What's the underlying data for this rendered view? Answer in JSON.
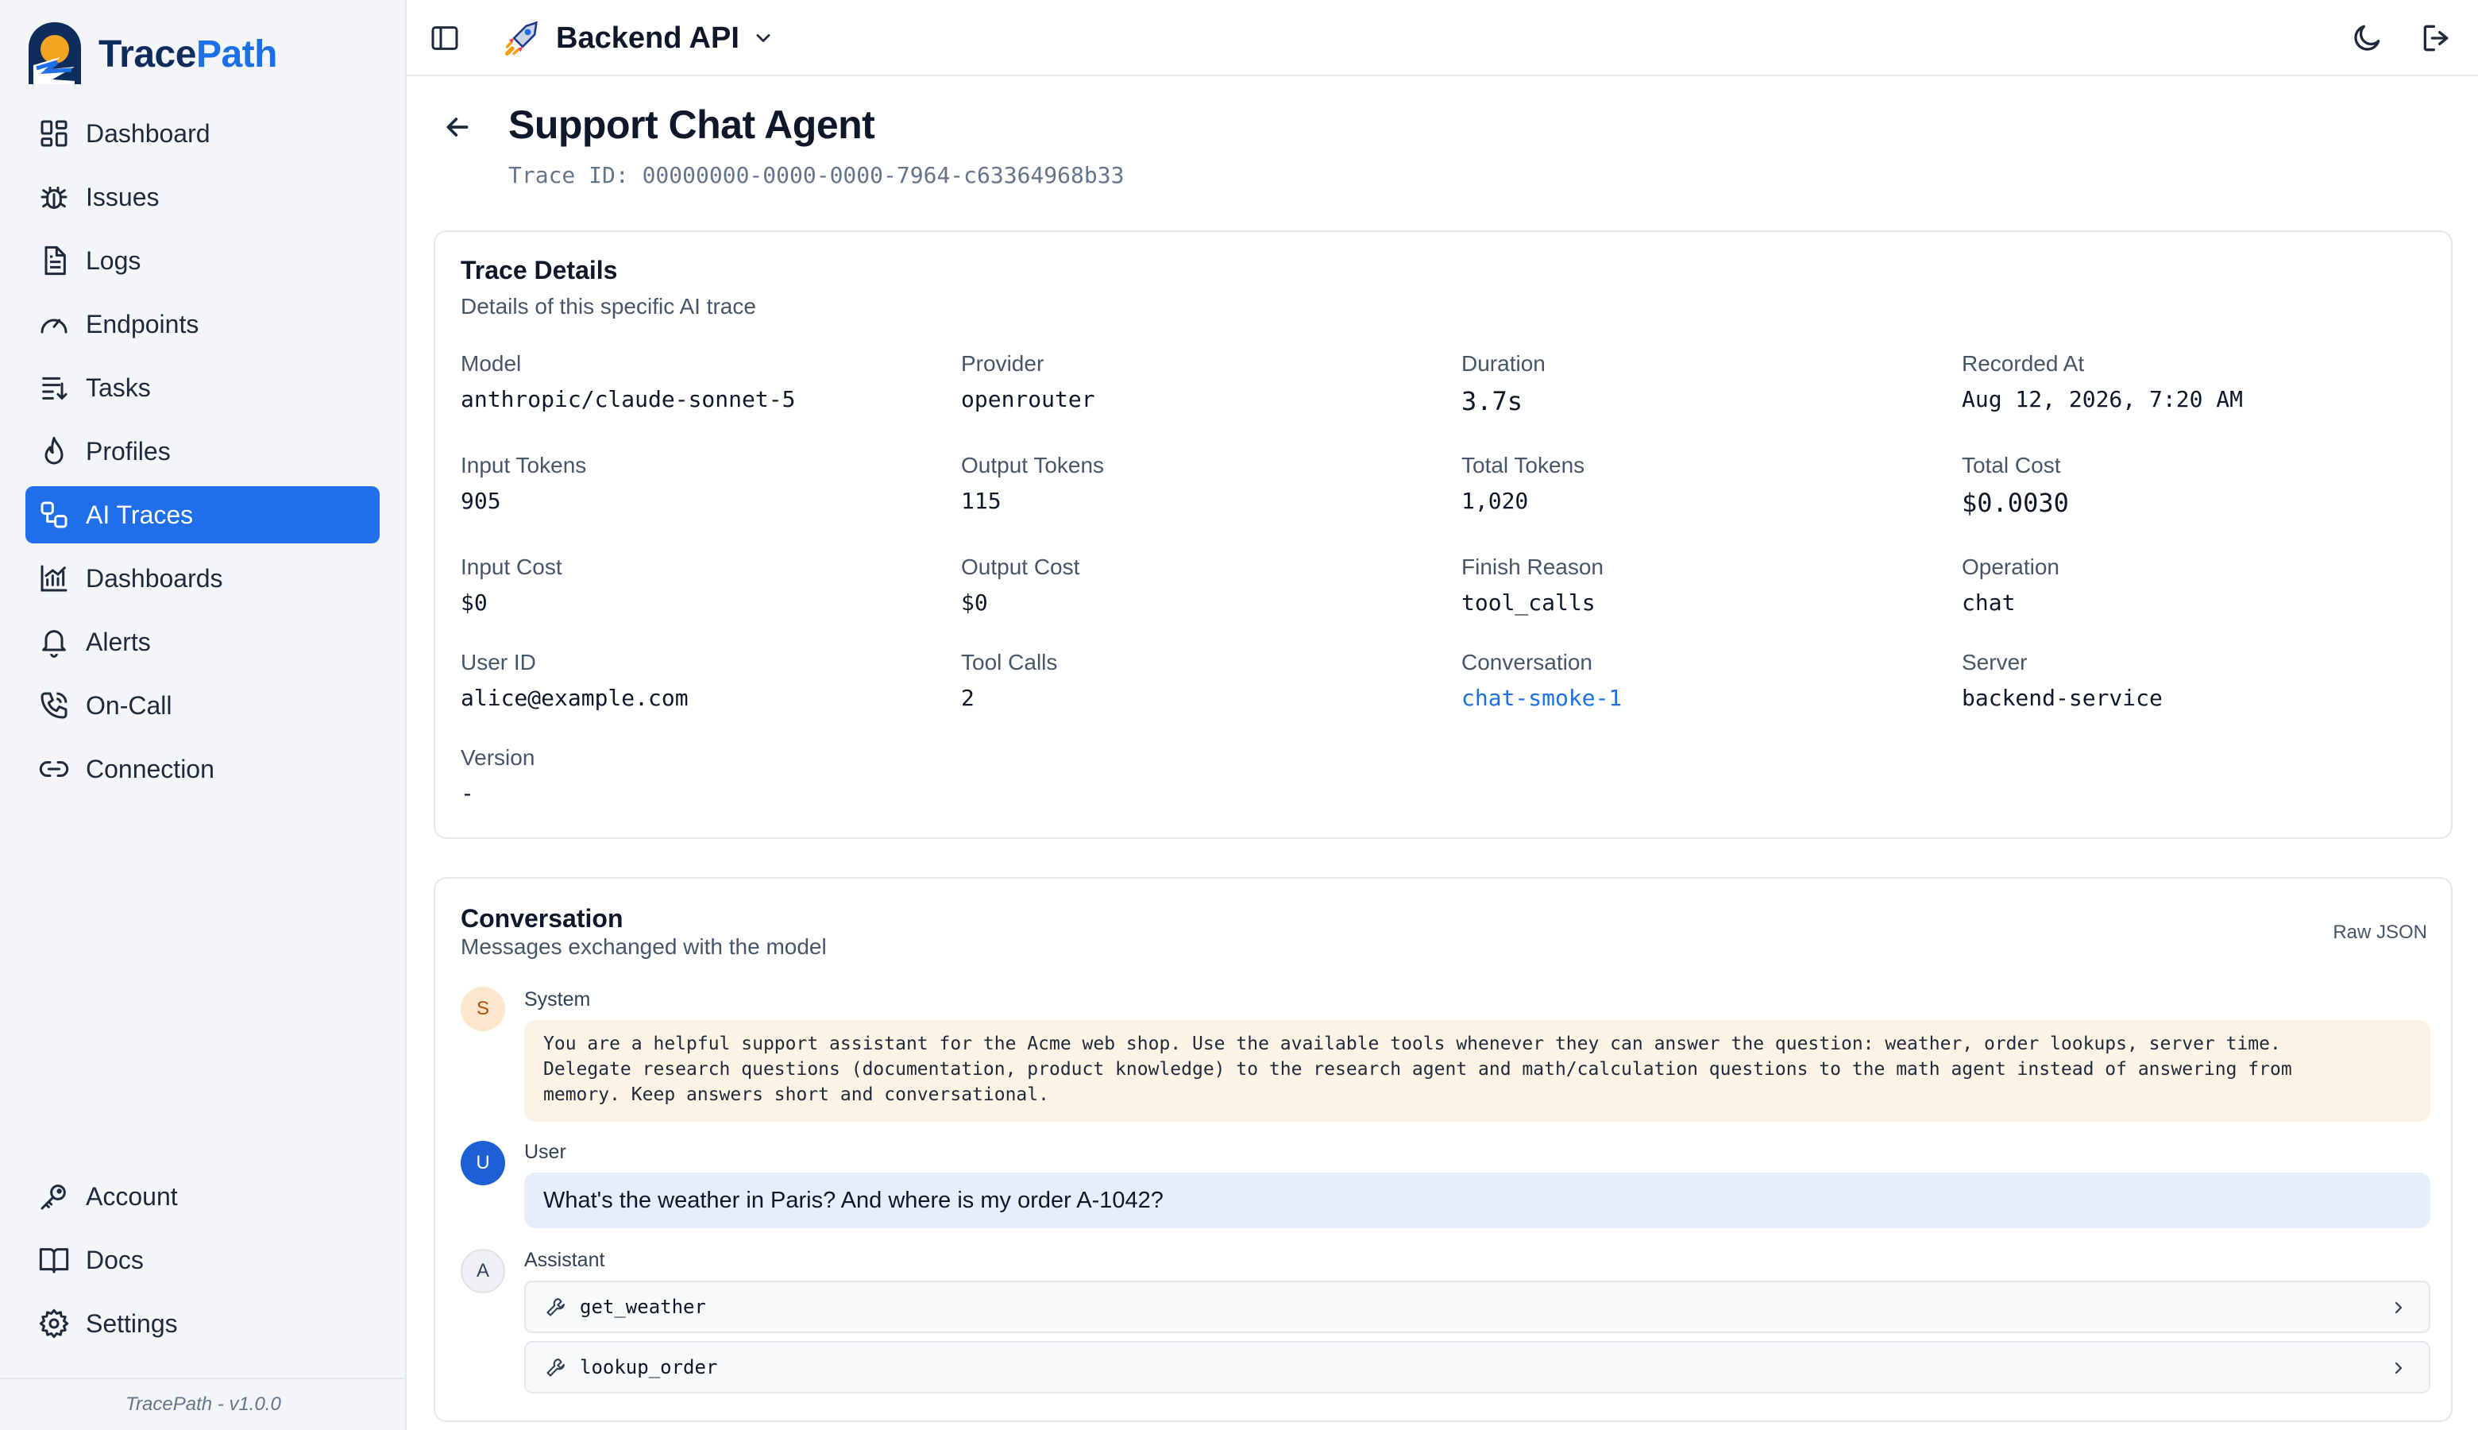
{
  "app": {
    "logo_trace": "Trace",
    "logo_path": "Path",
    "version": "TracePath - v1.0.0",
    "colors": {
      "accent": "#1f6feb",
      "link": "#1d6fe5",
      "system_bg": "#fdf3e4",
      "user_bg": "#e6edfb"
    }
  },
  "sidebar": {
    "items": [
      {
        "label": "Dashboard",
        "icon": "grid-icon"
      },
      {
        "label": "Issues",
        "icon": "bug-icon"
      },
      {
        "label": "Logs",
        "icon": "file-text-icon"
      },
      {
        "label": "Endpoints",
        "icon": "gauge-icon"
      },
      {
        "label": "Tasks",
        "icon": "list-icon"
      },
      {
        "label": "Profiles",
        "icon": "flame-icon"
      },
      {
        "label": "AI Traces",
        "icon": "workflow-icon",
        "active": true
      },
      {
        "label": "Dashboards",
        "icon": "chart-icon"
      },
      {
        "label": "Alerts",
        "icon": "bell-icon"
      },
      {
        "label": "On-Call",
        "icon": "phone-icon"
      },
      {
        "label": "Connection",
        "icon": "link-icon"
      }
    ],
    "bottom_items": [
      {
        "label": "Account",
        "icon": "key-icon"
      },
      {
        "label": "Docs",
        "icon": "book-icon"
      },
      {
        "label": "Settings",
        "icon": "gear-icon"
      }
    ]
  },
  "topbar": {
    "project_name": "Backend API"
  },
  "header": {
    "title": "Support Chat Agent",
    "trace_id": "Trace ID: 00000000-0000-0000-7964-c63364968b33"
  },
  "details": {
    "title": "Trace Details",
    "subtitle": "Details of this specific AI trace",
    "fields": {
      "model": {
        "label": "Model",
        "value": "anthropic/claude-sonnet-5"
      },
      "provider": {
        "label": "Provider",
        "value": "openrouter"
      },
      "duration": {
        "label": "Duration",
        "value": "3.7s"
      },
      "recorded_at": {
        "label": "Recorded At",
        "value": "Aug 12, 2026, 7:20 AM"
      },
      "input_tokens": {
        "label": "Input Tokens",
        "value": "905"
      },
      "output_tokens": {
        "label": "Output Tokens",
        "value": "115"
      },
      "total_tokens": {
        "label": "Total Tokens",
        "value": "1,020"
      },
      "total_cost": {
        "label": "Total Cost",
        "value": "$0.0030"
      },
      "input_cost": {
        "label": "Input Cost",
        "value": "$0"
      },
      "output_cost": {
        "label": "Output Cost",
        "value": "$0"
      },
      "finish_reason": {
        "label": "Finish Reason",
        "value": "tool_calls"
      },
      "operation": {
        "label": "Operation",
        "value": "chat"
      },
      "user_id": {
        "label": "User ID",
        "value": "alice@example.com"
      },
      "tool_calls": {
        "label": "Tool Calls",
        "value": "2"
      },
      "conversation": {
        "label": "Conversation",
        "value": "chat-smoke-1"
      },
      "server": {
        "label": "Server",
        "value": "backend-service"
      },
      "version": {
        "label": "Version",
        "value": "-"
      }
    }
  },
  "conversation": {
    "title": "Conversation",
    "subtitle": "Messages exchanged with the model",
    "raw_json_label": "Raw JSON",
    "system": {
      "avatar": "S",
      "role": "System",
      "lines": [
        "You are a helpful support assistant for the Acme web shop. Use the available tools whenever they can answer the question: weather, order lookups, server time.",
        "Delegate research questions (documentation, product knowledge) to the research agent and math/calculation questions to the math agent instead of answering from",
        "memory. Keep answers short and conversational."
      ]
    },
    "user": {
      "avatar": "U",
      "role": "User",
      "text": "What's the weather in Paris? And where is my order A-1042?"
    },
    "assistant": {
      "avatar": "A",
      "role": "Assistant",
      "tool_calls": [
        "get_weather",
        "lookup_order"
      ]
    }
  }
}
